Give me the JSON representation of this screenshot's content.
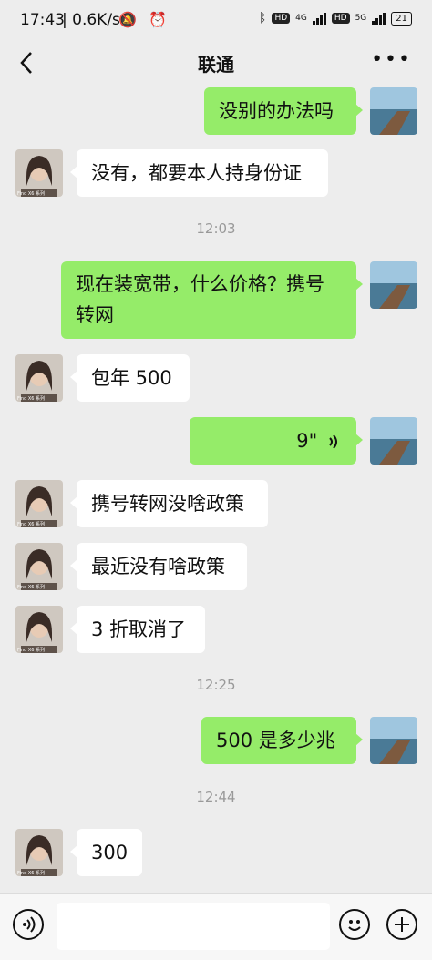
{
  "status_bar": {
    "time": "17:43",
    "network_speed": "| 0.6K/s",
    "status_icons": "🔕 ⏰",
    "sim1_badge": "HD",
    "sim1_net": "4G",
    "sim2_badge": "HD",
    "sim2_net": "5G",
    "battery": "21"
  },
  "header": {
    "title": "联通",
    "more_label": "•••"
  },
  "chat": {
    "messages": [
      {
        "text": "没别的办法吗",
        "sender": "self"
      },
      {
        "text": "没有，都要本人持身份证",
        "sender": "other"
      },
      {
        "text": "现在装宽带，什么价格？携号转网",
        "sender": "self"
      },
      {
        "text": "包年 500",
        "sender": "other"
      },
      {
        "text": "9\"",
        "sender": "self",
        "type": "voice"
      },
      {
        "text": "携号转网没啥政策",
        "sender": "other"
      },
      {
        "text": "最近没有啥政策",
        "sender": "other"
      },
      {
        "text": "3 折取消了",
        "sender": "other"
      },
      {
        "text": "500 是多少兆",
        "sender": "self"
      },
      {
        "text": "300",
        "sender": "other"
      }
    ],
    "timestamps": [
      "12:03",
      "12:25",
      "12:44"
    ]
  },
  "avatar_caption": "Find X6 系列",
  "colors": {
    "background": "#ededed",
    "outgoing_bubble": "#95ec69",
    "incoming_bubble": "#ffffff"
  }
}
